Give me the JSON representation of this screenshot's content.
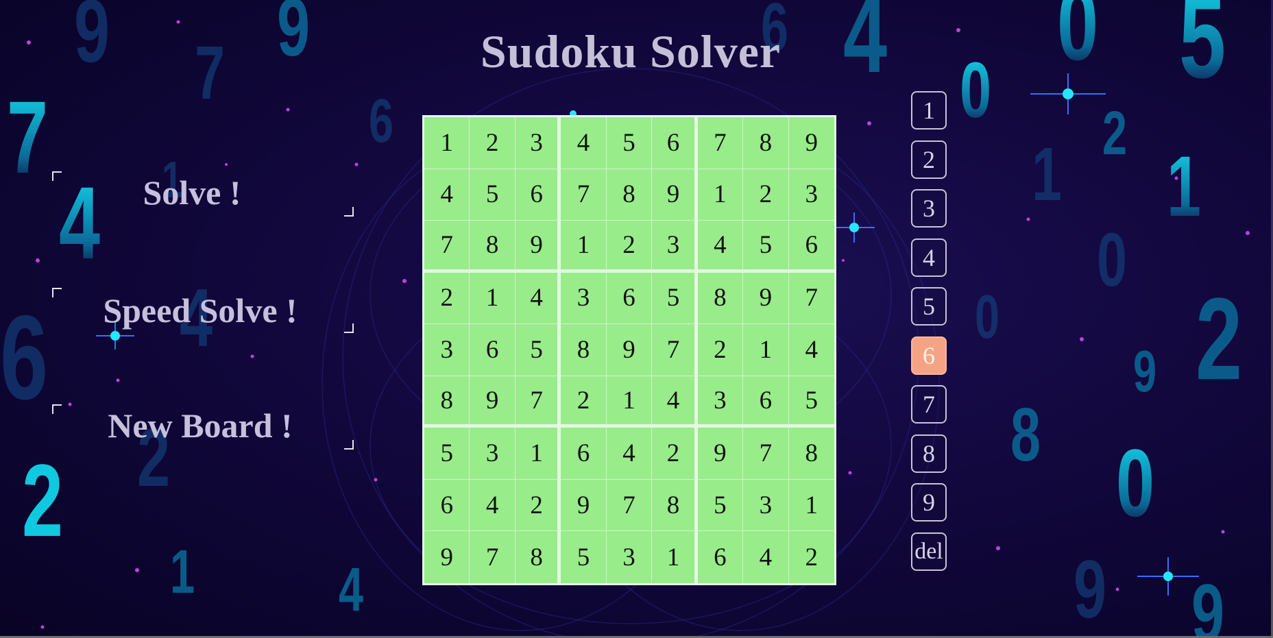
{
  "app": {
    "title": "Sudoku Solver"
  },
  "actions": [
    {
      "id": "solve",
      "label": "Solve !"
    },
    {
      "id": "speed-solve",
      "label": "Speed Solve !"
    },
    {
      "id": "new-board",
      "label": "New Board !"
    }
  ],
  "board": {
    "rows": [
      [
        "1",
        "2",
        "3",
        "4",
        "5",
        "6",
        "7",
        "8",
        "9"
      ],
      [
        "4",
        "5",
        "6",
        "7",
        "8",
        "9",
        "1",
        "2",
        "3"
      ],
      [
        "7",
        "8",
        "9",
        "1",
        "2",
        "3",
        "4",
        "5",
        "6"
      ],
      [
        "2",
        "1",
        "4",
        "3",
        "6",
        "5",
        "8",
        "9",
        "7"
      ],
      [
        "3",
        "6",
        "5",
        "8",
        "9",
        "7",
        "2",
        "1",
        "4"
      ],
      [
        "8",
        "9",
        "7",
        "2",
        "1",
        "4",
        "3",
        "6",
        "5"
      ],
      [
        "5",
        "3",
        "1",
        "6",
        "4",
        "2",
        "9",
        "7",
        "8"
      ],
      [
        "6",
        "4",
        "2",
        "9",
        "7",
        "8",
        "5",
        "3",
        "1"
      ],
      [
        "9",
        "7",
        "8",
        "5",
        "3",
        "1",
        "6",
        "4",
        "2"
      ]
    ]
  },
  "numpad": {
    "buttons": [
      "1",
      "2",
      "3",
      "4",
      "5",
      "6",
      "7",
      "8",
      "9",
      "del"
    ],
    "selected": "6"
  },
  "colors": {
    "cell": "#98ec8a",
    "grid_lines": "#e4f8e2",
    "selected_key": "#f4a484",
    "background": "#13083f",
    "title_text": "#c4c0d8"
  }
}
